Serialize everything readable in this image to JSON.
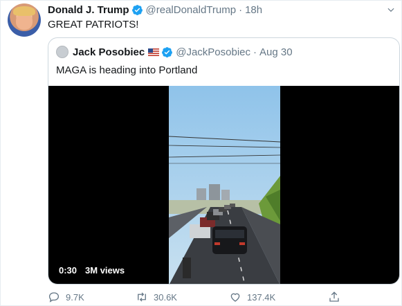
{
  "tweet": {
    "author_name": "Donald J. Trump",
    "author_handle": "@realDonaldTrump",
    "separator": "·",
    "timestamp": "18h",
    "text": "GREAT PATRIOTS!"
  },
  "quoted": {
    "author_name": "Jack Posobiec",
    "author_handle": "@JackPosobiec",
    "separator": "·",
    "timestamp": "Aug 30",
    "text": "MAGA is heading into Portland",
    "video": {
      "duration": "0:30",
      "views": "3M views"
    }
  },
  "actions": {
    "replies": "9.7K",
    "retweets": "30.6K",
    "likes": "137.4K"
  },
  "colors": {
    "verified_blue": "#1da1f2",
    "muted_gray": "#657786",
    "border": "#ccd6dd"
  },
  "icons": [
    "verified-badge-icon",
    "us-flag-icon",
    "reply-icon",
    "retweet-icon",
    "like-icon",
    "share-icon",
    "caret-down-icon"
  ]
}
